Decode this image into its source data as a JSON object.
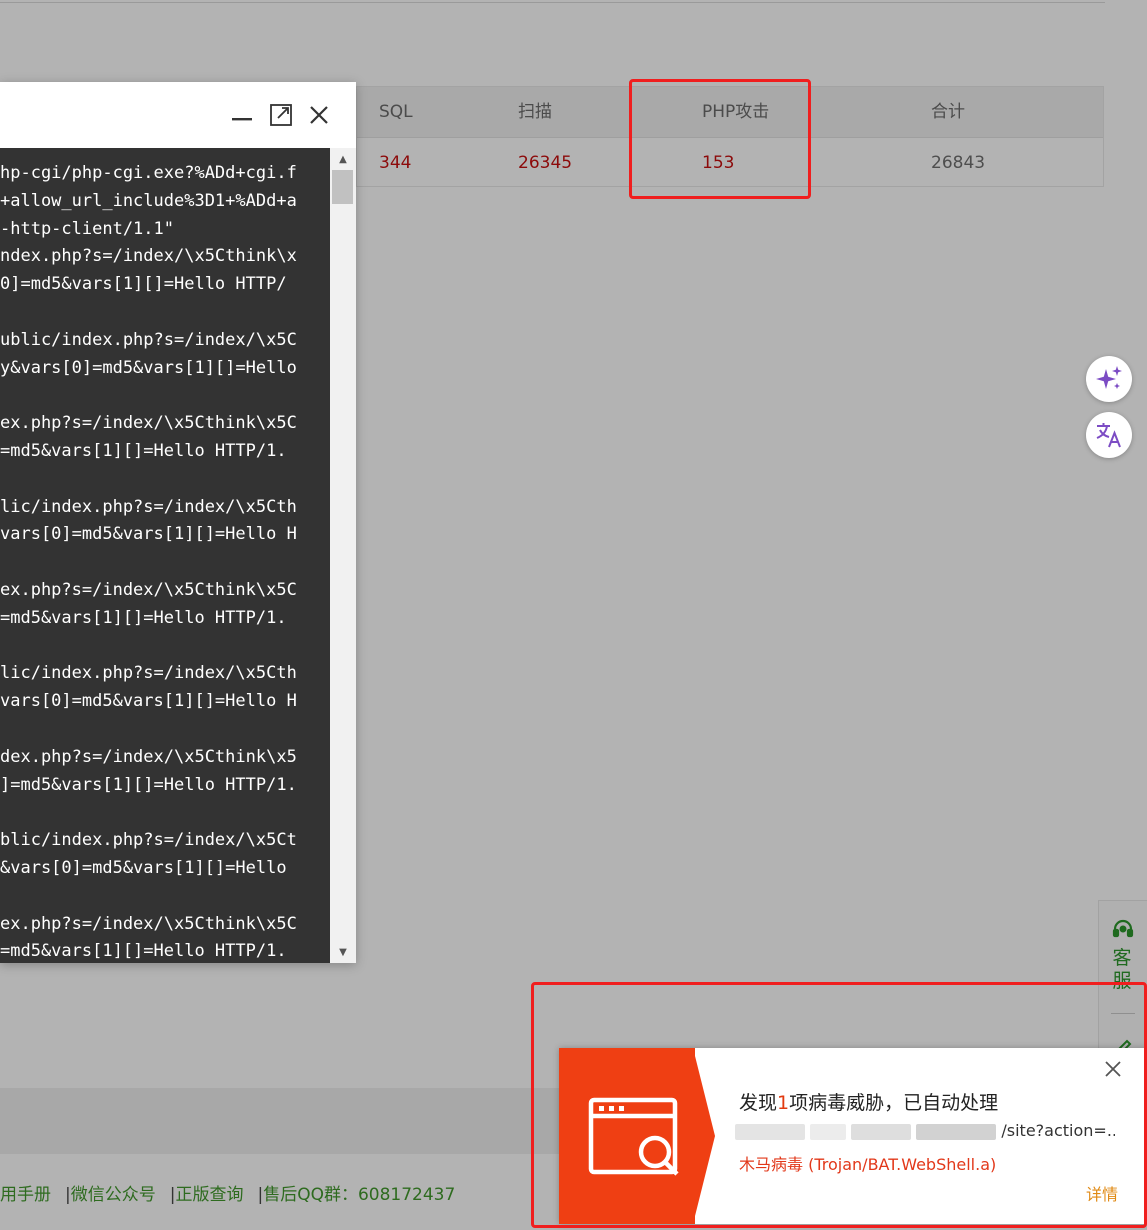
{
  "stats": {
    "headers": [
      "SQL",
      "扫描",
      "PHP攻击",
      "合计"
    ],
    "values": [
      "344",
      "26345",
      "153",
      "26843"
    ]
  },
  "log_dialog": {
    "minimize_label": "—",
    "lines": [
      "hp-cgi/php-cgi.exe?%ADd+cgi.f",
      "+allow_url_include%3D1+%ADd+a",
      "-http-client/1.1\"",
      "ndex.php?s=/index/\\x5Cthink\\x",
      "0]=md5&vars[1][]=Hello HTTP/",
      "",
      "ublic/index.php?s=/index/\\x5C",
      "y&vars[0]=md5&vars[1][]=Hello",
      "",
      "ex.php?s=/index/\\x5Cthink\\x5C",
      "=md5&vars[1][]=Hello HTTP/1.",
      "",
      "lic/index.php?s=/index/\\x5Cth",
      "vars[0]=md5&vars[1][]=Hello H",
      "",
      "ex.php?s=/index/\\x5Cthink\\x5C",
      "=md5&vars[1][]=Hello HTTP/1.",
      "",
      "lic/index.php?s=/index/\\x5Cth",
      "vars[0]=md5&vars[1][]=Hello H",
      "",
      "dex.php?s=/index/\\x5Cthink\\x5",
      "]=md5&vars[1][]=Hello HTTP/1.",
      "",
      "blic/index.php?s=/index/\\x5Ct",
      "&vars[0]=md5&vars[1][]=Hello",
      "",
      "ex.php?s=/index/\\x5Cthink\\x5C",
      "=md5&vars[1][]=Hello HTTP/1."
    ]
  },
  "side_tab": {
    "label": "客服"
  },
  "footer": {
    "links": [
      "用手册",
      "微信公众号",
      "正版查询",
      "售后QQ群：608172437"
    ],
    "separator": "|"
  },
  "toast": {
    "title_prefix": "发现",
    "title_count": "1",
    "title_suffix": "项病毒威胁，已自动处理",
    "url_tail": "/site?action=...",
    "threat_prefix": "木马病毒",
    "threat_name": " (Trojan/BAT.WebShell.a)",
    "details_label": "详情"
  },
  "colors": {
    "highlight": "#f01e1e",
    "toast_banner": "#ef3f13",
    "threat_text": "#e2381a",
    "details_link": "#e08a14",
    "footer_link": "#2e6b1f",
    "ai_icon": "#7c4cc4"
  }
}
